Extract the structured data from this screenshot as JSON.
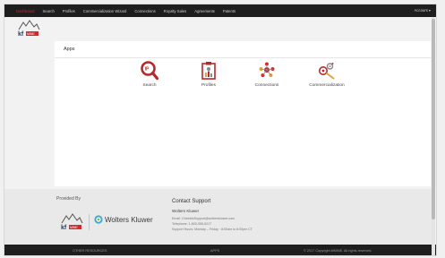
{
  "nav": {
    "items": [
      "Dashboard",
      "Search",
      "Profiles",
      "Commercialization Wizard",
      "Connections",
      "Royalty Sales",
      "Agreements",
      "Patents"
    ],
    "active_index": 0,
    "account_label": "Account ▾"
  },
  "brand": {
    "logo_text": "kfMINE",
    "accent": "#d9262a"
  },
  "apps": {
    "title": "Apps",
    "items": [
      {
        "label": "Search",
        "icon": "search-icon"
      },
      {
        "label": "Profiles",
        "icon": "profiles-icon"
      },
      {
        "label": "Connections",
        "icon": "connections-icon"
      },
      {
        "label": "Commercialization",
        "icon": "commercialization-icon"
      }
    ]
  },
  "footer": {
    "provided_by": "Provided By",
    "partner_name": "Wolters Kluwer",
    "support_title": "Contact Support",
    "support_company": "Wolters Kluwer",
    "support_email": "Email: CheetahSupport@wolterskluwer.com",
    "support_phone": "Telephone: 1-800-955-5217",
    "support_hours": "Support Hours: Monday – Friday · 8:00am to 6:00pm CT"
  },
  "bottom_bar": {
    "left": "OTHER RESOURCES",
    "center": "APPS",
    "right": "© 2017 Copyright kfMINE. All rights reserved."
  }
}
